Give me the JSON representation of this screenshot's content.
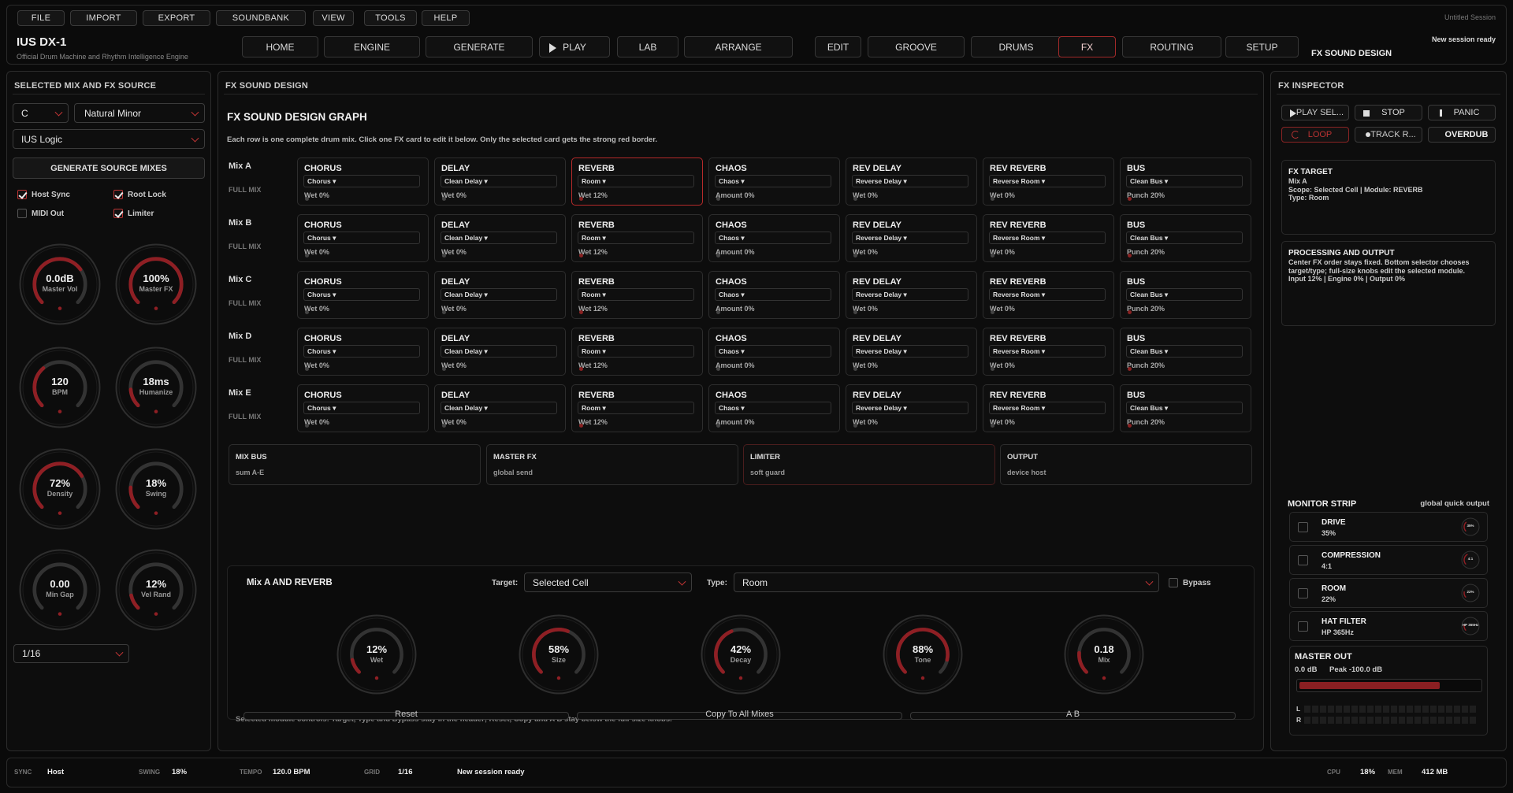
{
  "menu": [
    "FILE",
    "IMPORT",
    "EXPORT",
    "SOUNDBANK",
    "VIEW",
    "TOOLS",
    "HELP"
  ],
  "session_title": "Untitled Session",
  "app": {
    "name": "IUS DX-1",
    "subtitle": "Official Drum Machine and Rhythm Intelligence Engine"
  },
  "nav": [
    {
      "label": "HOME",
      "active": false
    },
    {
      "label": "ENGINE",
      "active": false
    },
    {
      "label": "GENERATE",
      "active": false
    },
    {
      "label": "PLAY",
      "active": false,
      "icon": "play-icon"
    },
    {
      "label": "LAB",
      "active": false
    },
    {
      "label": "ARRANGE",
      "active": false
    },
    {
      "label": "EDIT",
      "active": false
    },
    {
      "label": "GROOVE",
      "active": false
    },
    {
      "label": "DRUMS",
      "active": false
    },
    {
      "label": "FX",
      "active": true
    },
    {
      "label": "ROUTING",
      "active": false
    },
    {
      "label": "SETUP",
      "active": false
    }
  ],
  "header_status": "New session ready",
  "header_context": "FX SOUND DESIGN",
  "left": {
    "title": "SELECTED MIX AND FX SOURCE",
    "key": "C",
    "scale": "Natural Minor",
    "mode": "IUS Logic",
    "generate_btn": "GENERATE SOURCE MIXES",
    "checks": [
      {
        "label": "Host Sync",
        "on": true
      },
      {
        "label": "Root Lock",
        "on": true
      },
      {
        "label": "MIDI Out",
        "on": false
      },
      {
        "label": "Limiter",
        "on": true
      }
    ],
    "knobs": [
      {
        "value": "0.0dB",
        "label": "Master Vol",
        "level": 0.7
      },
      {
        "value": "100%",
        "label": "Master FX",
        "level": 1.0
      },
      {
        "value": "120",
        "label": "BPM",
        "level": 0.35
      },
      {
        "value": "18ms",
        "label": "Humanize",
        "level": 0.15
      },
      {
        "value": "72%",
        "label": "Density",
        "level": 0.72
      },
      {
        "value": "18%",
        "label": "Swing",
        "level": 0.18
      },
      {
        "value": "0.00",
        "label": "Min Gap",
        "level": 0.0
      },
      {
        "value": "12%",
        "label": "Vel Rand",
        "level": 0.12
      }
    ],
    "grid": "1/16"
  },
  "center": {
    "panel_title": "FX SOUND DESIGN",
    "graph_title": "FX SOUND DESIGN GRAPH",
    "instructions": "Each row is one complete drum mix. Click one FX card to edit it below. Only the selected card gets the strong red border.",
    "row_sub": "FULL MIX",
    "rows": [
      {
        "label": "Mix A",
        "cells": [
          {
            "t": "CHORUS",
            "s": "Chorus ▾",
            "v": "Wet 0%"
          },
          {
            "t": "DELAY",
            "s": "Clean Delay ▾",
            "v": "Wet 0%"
          },
          {
            "t": "REVERB",
            "s": "Room ▾",
            "v": "Wet 12%",
            "sel": true
          },
          {
            "t": "CHAOS",
            "s": "Chaos ▾",
            "v": "Amount 0%"
          },
          {
            "t": "REV DELAY",
            "s": "Reverse Delay ▾",
            "v": "Wet 0%"
          },
          {
            "t": "REV REVERB",
            "s": "Reverse Room ▾",
            "v": "Wet 0%"
          },
          {
            "t": "BUS",
            "s": "Clean Bus ▾",
            "v": "Punch 20%"
          }
        ]
      },
      {
        "label": "Mix B",
        "cells": [
          {
            "t": "CHORUS",
            "s": "Chorus ▾",
            "v": "Wet 0%"
          },
          {
            "t": "DELAY",
            "s": "Clean Delay ▾",
            "v": "Wet 0%"
          },
          {
            "t": "REVERB",
            "s": "Room ▾",
            "v": "Wet 12%"
          },
          {
            "t": "CHAOS",
            "s": "Chaos ▾",
            "v": "Amount 0%"
          },
          {
            "t": "REV DELAY",
            "s": "Reverse Delay ▾",
            "v": "Wet 0%"
          },
          {
            "t": "REV REVERB",
            "s": "Reverse Room ▾",
            "v": "Wet 0%"
          },
          {
            "t": "BUS",
            "s": "Clean Bus ▾",
            "v": "Punch 20%"
          }
        ]
      },
      {
        "label": "Mix C",
        "cells": [
          {
            "t": "CHORUS",
            "s": "Chorus ▾",
            "v": "Wet 0%"
          },
          {
            "t": "DELAY",
            "s": "Clean Delay ▾",
            "v": "Wet 0%"
          },
          {
            "t": "REVERB",
            "s": "Room ▾",
            "v": "Wet 12%"
          },
          {
            "t": "CHAOS",
            "s": "Chaos ▾",
            "v": "Amount 0%"
          },
          {
            "t": "REV DELAY",
            "s": "Reverse Delay ▾",
            "v": "Wet 0%"
          },
          {
            "t": "REV REVERB",
            "s": "Reverse Room ▾",
            "v": "Wet 0%"
          },
          {
            "t": "BUS",
            "s": "Clean Bus ▾",
            "v": "Punch 20%"
          }
        ]
      },
      {
        "label": "Mix D",
        "cells": [
          {
            "t": "CHORUS",
            "s": "Chorus ▾",
            "v": "Wet 0%"
          },
          {
            "t": "DELAY",
            "s": "Clean Delay ▾",
            "v": "Wet 0%"
          },
          {
            "t": "REVERB",
            "s": "Room ▾",
            "v": "Wet 12%"
          },
          {
            "t": "CHAOS",
            "s": "Chaos ▾",
            "v": "Amount 0%"
          },
          {
            "t": "REV DELAY",
            "s": "Reverse Delay ▾",
            "v": "Wet 0%"
          },
          {
            "t": "REV REVERB",
            "s": "Reverse Room ▾",
            "v": "Wet 0%"
          },
          {
            "t": "BUS",
            "s": "Clean Bus ▾",
            "v": "Punch 20%"
          }
        ]
      },
      {
        "label": "Mix E",
        "cells": [
          {
            "t": "CHORUS",
            "s": "Chorus ▾",
            "v": "Wet 0%"
          },
          {
            "t": "DELAY",
            "s": "Clean Delay ▾",
            "v": "Wet 0%"
          },
          {
            "t": "REVERB",
            "s": "Room ▾",
            "v": "Wet 12%"
          },
          {
            "t": "CHAOS",
            "s": "Chaos ▾",
            "v": "Amount 0%"
          },
          {
            "t": "REV DELAY",
            "s": "Reverse Delay ▾",
            "v": "Wet 0%"
          },
          {
            "t": "REV REVERB",
            "s": "Reverse Room ▾",
            "v": "Wet 0%"
          },
          {
            "t": "BUS",
            "s": "Clean Bus ▾",
            "v": "Punch 20%"
          }
        ]
      }
    ],
    "bus": [
      {
        "t": "MIX BUS",
        "s": "sum A-E"
      },
      {
        "t": "MASTER FX",
        "s": "global send"
      },
      {
        "t": "LIMITER",
        "s": "soft guard"
      },
      {
        "t": "OUTPUT",
        "s": "device host"
      }
    ],
    "editor": {
      "title": "Mix A AND REVERB",
      "target_label": "Target:",
      "target_value": "Selected Cell",
      "type_label": "Type:",
      "type_value": "Room",
      "bypass_label": "Bypass",
      "knobs": [
        {
          "value": "12%",
          "label": "Wet",
          "level": 0.12
        },
        {
          "value": "58%",
          "label": "Size",
          "level": 0.58
        },
        {
          "value": "42%",
          "label": "Decay",
          "level": 0.42
        },
        {
          "value": "88%",
          "label": "Tone",
          "level": 0.88
        },
        {
          "value": "0.18",
          "label": "Mix",
          "level": 0.18
        }
      ],
      "buttons": [
        "Reset",
        "Copy To All Mixes",
        "A B"
      ],
      "footer_note": "Selected module controls: Target, Type and Bypass stay in the header; Reset, Copy and A B stay below the full-size knobs."
    }
  },
  "inspector": {
    "title": "FX INSPECTOR",
    "buttons": [
      {
        "label": "PLAY SEL...",
        "icon": "play-icon"
      },
      {
        "label": "STOP",
        "icon": "stop-icon"
      },
      {
        "label": "PANIC",
        "icon": "exclamation-icon"
      },
      {
        "label": "LOOP",
        "icon": "loop-icon",
        "active": true
      },
      {
        "label": "TRACK R...",
        "icon": "record-icon"
      },
      {
        "label": "OVERDUB"
      }
    ],
    "fx_target": {
      "title": "FX TARGET",
      "lines": "Mix A\nScope: Selected Cell | Module: REVERB\nType: Room"
    },
    "processing": {
      "title": "PROCESSING AND OUTPUT",
      "lines": "Center FX order stays fixed. Bottom selector chooses target/type; full-size knobs edit the selected module.\nInput 12% | Engine 0% | Output 0%"
    },
    "monitor": {
      "title": "MONITOR STRIP",
      "subtitle": "global quick output",
      "items": [
        {
          "t": "DRIVE",
          "v": "35%",
          "k": "35%",
          "level": 0.35
        },
        {
          "t": "COMPRESSION",
          "v": "4:1",
          "k": "4:1",
          "level": 0.4
        },
        {
          "t": "ROOM",
          "v": "22%",
          "k": "22%",
          "level": 0.22
        },
        {
          "t": "HAT FILTER",
          "v": "HP 365Hz",
          "k": "HP 365Hz",
          "level": 0.2
        }
      ]
    },
    "master_out": {
      "title": "MASTER OUT",
      "db": "0.0 dB",
      "peak": "Peak -100.0 dB",
      "level": 0.78,
      "L": "L",
      "R": "R"
    }
  },
  "statusbar": {
    "sync_label": "SYNC",
    "sync": "Host",
    "swing_label": "SWING",
    "swing": "18%",
    "tempo_label": "TEMPO",
    "tempo": "120.0 BPM",
    "grid_label": "GRID",
    "grid": "1/16",
    "message": "New session ready",
    "cpu_label": "CPU",
    "cpu": "18%",
    "mem_label": "MEM",
    "mem": "412 MB"
  },
  "colors": {
    "accent": "#b52a2a",
    "bg": "#0a0a0a",
    "panel": "#0d0d0d"
  }
}
